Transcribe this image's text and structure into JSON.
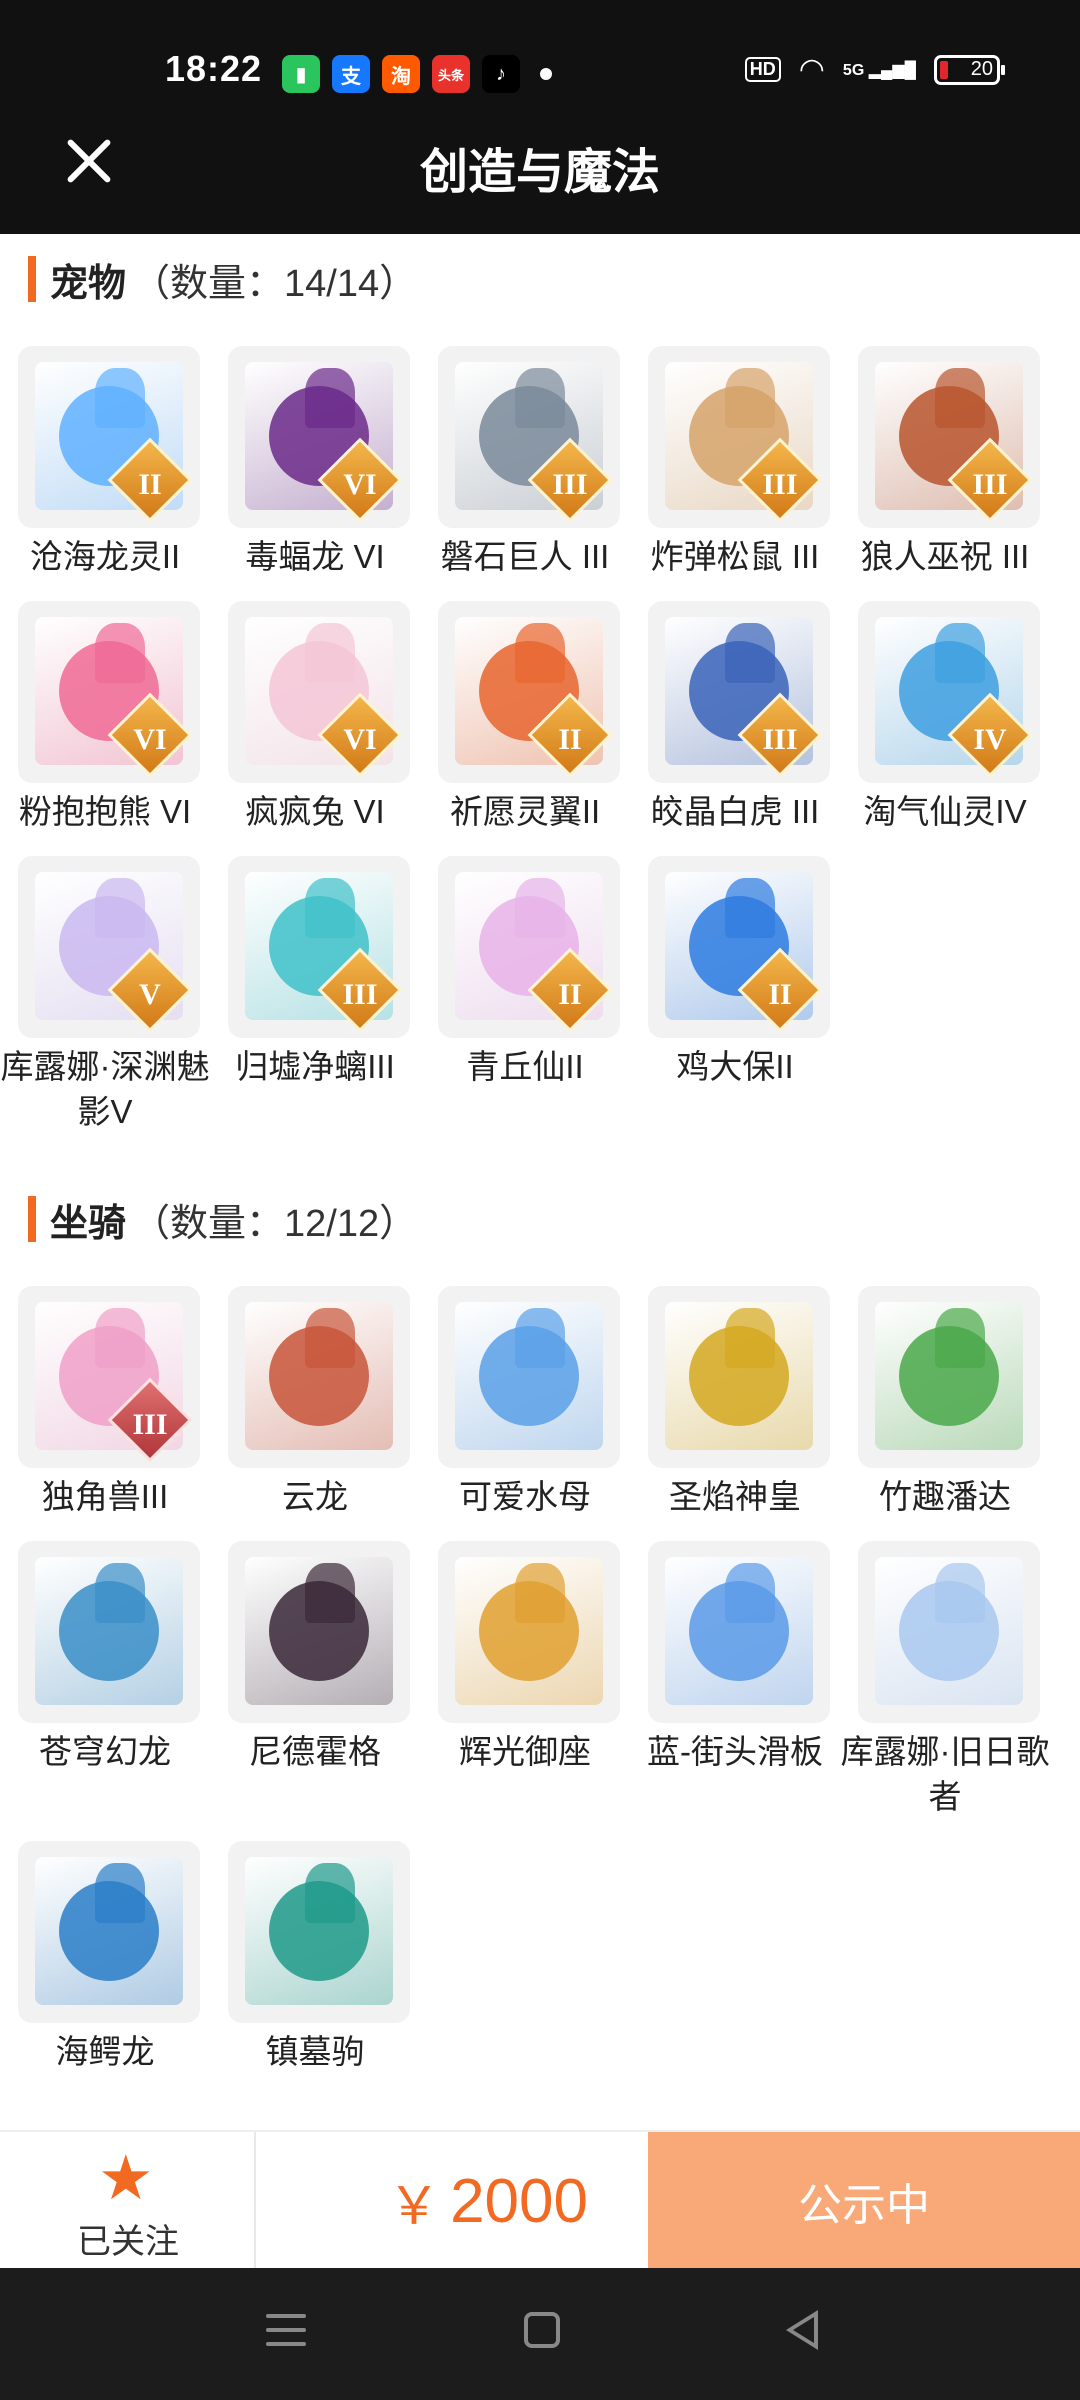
{
  "status_bar": {
    "time": "18:22",
    "apps": [
      "battery-app-icon",
      "alipay-icon",
      "taobao-icon",
      "toutiao-icon",
      "tiktok-icon"
    ],
    "app_glyphs": [
      "▮",
      "支",
      "淘",
      "头条",
      "♪"
    ],
    "app_colors": [
      "#2ac55d",
      "#1677ff",
      "#ff5a00",
      "#e8322b",
      "#000000"
    ],
    "hd": "HD",
    "network": "5G",
    "battery": "20"
  },
  "header": {
    "title": "创造与魔法"
  },
  "sections": [
    {
      "name": "宠物",
      "count": "（数量：14/14）",
      "items": [
        {
          "label": "沧海龙灵II",
          "badge": "II",
          "color": "#5fb0ff"
        },
        {
          "label": "毒蝠龙 VI",
          "badge": "VI",
          "color": "#6b2a8a"
        },
        {
          "label": "磐石巨人 III",
          "badge": "III",
          "color": "#7a8a9a"
        },
        {
          "label": "炸弹松鼠 III",
          "badge": "III",
          "color": "#d6a36a"
        },
        {
          "label": "狼人巫祝 III",
          "badge": "III",
          "color": "#b8552e"
        },
        {
          "label": "粉抱抱熊 VI",
          "badge": "VI",
          "color": "#f06a95"
        },
        {
          "label": "疯疯兔 VI",
          "badge": "VI",
          "color": "#f4c6d6"
        },
        {
          "label": "祈愿灵翼II",
          "badge": "II",
          "color": "#e8652f"
        },
        {
          "label": "皎晶白虎 III",
          "badge": "III",
          "color": "#3a63b8"
        },
        {
          "label": "淘气仙灵IV",
          "badge": "IV",
          "color": "#3e9fe0"
        },
        {
          "label": "库露娜·深渊魅影V",
          "badge": "V",
          "color": "#c9b8f0"
        },
        {
          "label": "归墟净螭III",
          "badge": "III",
          "color": "#3fc1c9"
        },
        {
          "label": "青丘仙II",
          "badge": "II",
          "color": "#e7b3e8"
        },
        {
          "label": "鸡大保II",
          "badge": "II",
          "color": "#2d7be0"
        }
      ]
    },
    {
      "name": "坐骑",
      "count": "（数量：12/12）",
      "items": [
        {
          "label": "独角兽III",
          "badge": "III",
          "color": "#f0a0c8"
        },
        {
          "label": "云龙",
          "badge": "",
          "color": "#c8553a"
        },
        {
          "label": "可爱水母",
          "badge": "",
          "color": "#5aa0e8"
        },
        {
          "label": "圣焰神皇",
          "badge": "",
          "color": "#d4a820"
        },
        {
          "label": "竹趣潘达",
          "badge": "",
          "color": "#4aa84a"
        },
        {
          "label": "苍穹幻龙",
          "badge": "",
          "color": "#3a8ec8"
        },
        {
          "label": "尼德霍格",
          "badge": "",
          "color": "#3a2838"
        },
        {
          "label": "辉光御座",
          "badge": "",
          "color": "#e0a030"
        },
        {
          "label": "蓝-街头滑板",
          "badge": "",
          "color": "#5a9ae8"
        },
        {
          "label": "库露娜·旧日歌者",
          "badge": "",
          "color": "#a8c8f0"
        },
        {
          "label": "海鳄龙",
          "badge": "",
          "color": "#2a7ec8"
        },
        {
          "label": "镇墓驹",
          "badge": "",
          "color": "#1e9a8a"
        }
      ]
    }
  ],
  "action_bar": {
    "follow_label": "已关注",
    "currency": "￥",
    "price": "2000",
    "status_label": "公示中"
  }
}
